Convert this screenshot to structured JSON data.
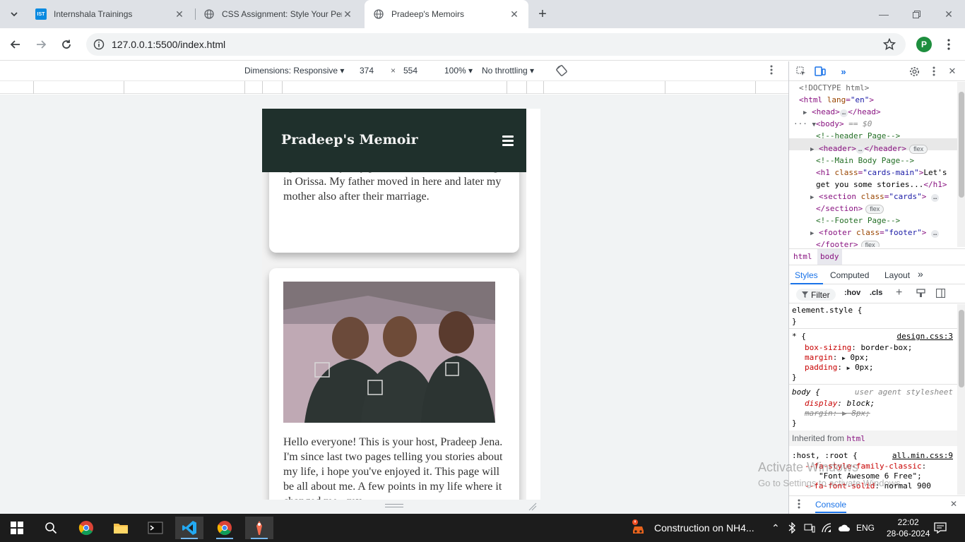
{
  "browser": {
    "tabs": [
      {
        "title": "Internshala Trainings",
        "favicon": "IST"
      },
      {
        "title": "CSS Assignment: Style Your Pers",
        "favicon": "globe-icon"
      },
      {
        "title": "Pradeep's Memoirs",
        "favicon": "globe-icon"
      }
    ],
    "url": "127.0.0.1:5500/index.html",
    "profile_initial": "P"
  },
  "device_toolbar": {
    "dimensions_label": "Dimensions: Responsive",
    "width": "374",
    "height": "554",
    "times": "×",
    "zoom": "100%",
    "throttling": "No throttling"
  },
  "site": {
    "title": "Pradeep's Memoir",
    "card1_text": "tell you I'm a middle class boy born and baught up in this city. My parents are from small village in Orissa. My father moved in here and later my mother also after their marriage.",
    "card2_text": "Hello everyone! This is your host, Pradeep Jena. I'm since last two pages telling you stories about my life, i hope you've enjoyed it. This page will be all about me. A few points in my life where it changed me - my"
  },
  "devtools": {
    "elements": {
      "doctype": "<!DOCTYPE html>",
      "html_open": "<html",
      "html_attr": "lang",
      "html_val": "\"en\"",
      "head": "<head>",
      "head_close": "</head>",
      "body": "<body>",
      "body_eq": "== $0",
      "cmt_header": "<!--header Page-->",
      "header": "<header>",
      "header_close": "</header>",
      "cmt_main": "<!--Main Body Page-->",
      "h1_open": "<h1",
      "h1_attr": "class",
      "h1_val": "\"cards-main\"",
      "h1_text1": "Let's",
      "h1_text2": "get you some stories...",
      "h1_close": "</h1>",
      "section_open": "<section",
      "section_attr": "class",
      "section_val": "\"cards\"",
      "section_close": "</section>",
      "cmt_footer": "<!--Footer Page-->",
      "footer_open": "<footer",
      "footer_attr": "class",
      "footer_val": "\"footer\"",
      "footer_close": "</footer>",
      "flex_badge": "flex",
      "ellipsis": "…"
    },
    "breadcrumbs": [
      "html",
      "body"
    ],
    "subtabs": [
      "Styles",
      "Computed",
      "Layout"
    ],
    "filter_label": "Filter",
    "hov": ":hov",
    "cls": ".cls",
    "styles": {
      "element_style": "element.style {",
      "close_brace": "}",
      "star_rule": "* {",
      "star_source": "design.css:3",
      "box_sizing_prop": "box-sizing",
      "box_sizing_val": "border-box;",
      "margin_prop": "margin",
      "margin_val": "0px;",
      "padding_prop": "padding",
      "padding_val": "0px;",
      "body_rule": "body {",
      "ua_source": "user agent stylesheet",
      "display_prop": "display",
      "display_val": "block;",
      "ua_margin_prop": "margin",
      "ua_margin_val": "8px;",
      "inherited_label": "Inherited from",
      "inherited_tag": "html",
      "host_rule": ":host, :root {",
      "host_source": "all.min.css:9",
      "fa_family_prop": "--fa-style-family-classic",
      "fa_family_val": "\"Font Awesome 6 Free\";",
      "fa_solid_prop": "--fa-font-solid",
      "fa_solid_val": "normal 900"
    },
    "console_label": "Console"
  },
  "watermark": {
    "line1": "Activate Windows",
    "line2": "Go to Settings to activate Windows."
  },
  "taskbar": {
    "notification": "Construction on NH4...",
    "lang": "ENG",
    "time": "22:02",
    "date": "28-06-2024"
  }
}
